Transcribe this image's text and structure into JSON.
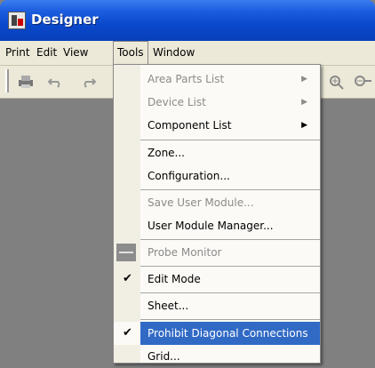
{
  "window": {
    "title": "Designer"
  },
  "menubar": [
    {
      "label": "Print",
      "active": false
    },
    {
      "label": "Edit",
      "active": false
    },
    {
      "label": "View",
      "active": false
    },
    {
      "label": "Tools",
      "active": true
    },
    {
      "label": "Window",
      "active": false
    }
  ],
  "toolbar": {
    "icons": [
      "print-icon",
      "undo-icon",
      "redo-icon",
      "zoom-icon",
      "zoom-out-icon"
    ]
  },
  "tools_menu": {
    "items": [
      {
        "label": "Area Parts List",
        "disabled": true,
        "submenu": true
      },
      {
        "label": "Device List",
        "disabled": true,
        "submenu": true
      },
      {
        "label": "Component List",
        "disabled": false,
        "submenu": true
      },
      {
        "label": "Zone...",
        "disabled": false
      },
      {
        "label": "Configuration...",
        "disabled": false
      },
      {
        "label": "Save User Module...",
        "disabled": true
      },
      {
        "label": "User Module Manager...",
        "disabled": false
      },
      {
        "label": "Probe Monitor",
        "disabled": true,
        "icon": "probe-icon"
      },
      {
        "label": "Edit Mode",
        "disabled": false,
        "checked": true
      },
      {
        "label": "Sheet...",
        "disabled": false
      },
      {
        "label": "Prohibit Diagonal Connections",
        "disabled": false,
        "checked": true,
        "highlighted": true
      },
      {
        "label": "Grid...",
        "disabled": false
      }
    ]
  },
  "colors": {
    "title_bar": "#0a48cc",
    "menu_highlight": "#316ac5",
    "workspace": "#808080"
  }
}
